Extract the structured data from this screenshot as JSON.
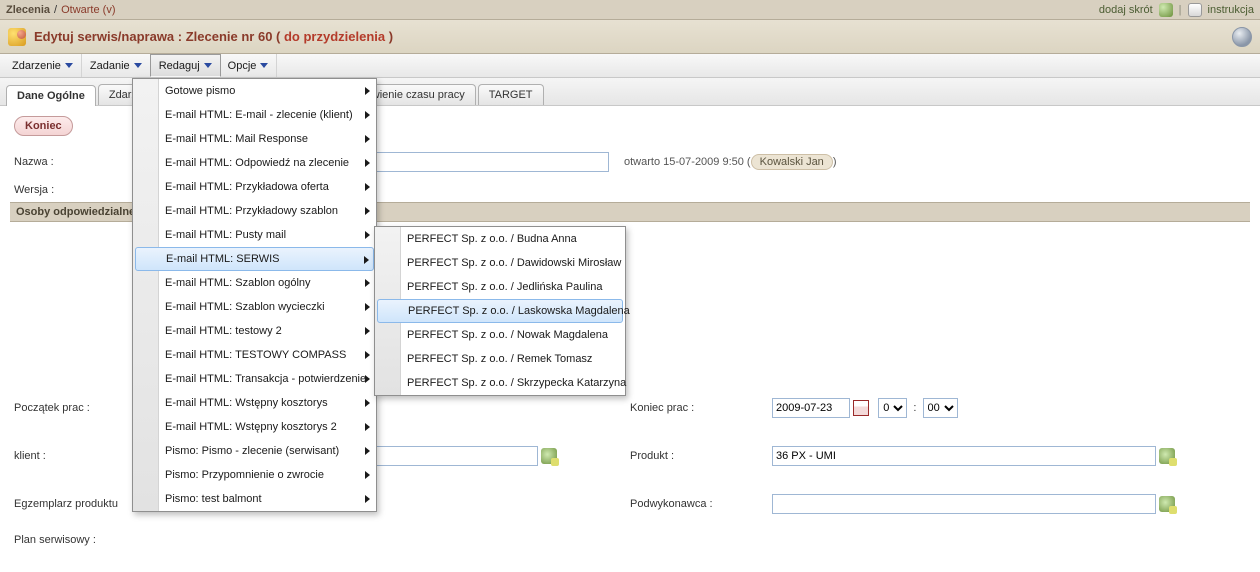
{
  "breadcrumb": {
    "root": "Zlecenia",
    "sep": "/",
    "current": "Otwarte (v)"
  },
  "toplinks": {
    "shortcut": "dodaj skrót",
    "instruction": "instrukcja"
  },
  "title": {
    "main": "Edytuj serwis/naprawa : Zlecenie nr 60 (",
    "status": " do przydzielenia ",
    "close": ")"
  },
  "menubar": {
    "items": [
      "Zdarzenie",
      "Zadanie",
      "Redaguj",
      "Opcje"
    ],
    "openIndex": 2
  },
  "tabs": {
    "items": [
      "Dane Ogólne",
      "Zdarzenia",
      "wienie czasu pracy",
      "TARGET"
    ],
    "activeIndex": 0
  },
  "buttons": {
    "koniec": "Koniec"
  },
  "labels": {
    "nazwa": "Nazwa :",
    "wersja": "Wersja :",
    "osoby": "Osoby odpowiedzialne",
    "poczatek": "Początek prac :",
    "koniecprac": "Koniec prac :",
    "klient": "klient :",
    "produkt": "Produkt :",
    "egzemplarz": "Egzemplarz produktu",
    "podwykonawca": "Podwykonawca :",
    "plan": "Plan serwisowy :"
  },
  "opened": {
    "prefix": "otwarto",
    "date": "15-07-2009 9:50",
    "who": "Kowalski Jan"
  },
  "fields": {
    "koniec_data": "2009-07-23",
    "koniec_godz": "0",
    "koniec_min": "00",
    "time_sep": ":",
    "produkt": "36 PX - UMI",
    "klient": "",
    "podwykonawca": ""
  },
  "redaguj_menu": {
    "items": [
      "Gotowe pismo",
      "E-mail HTML: E-mail - zlecenie (klient)",
      "E-mail HTML: Mail Response",
      "E-mail HTML: Odpowiedź na zlecenie",
      "E-mail HTML: Przykładowa oferta",
      "E-mail HTML: Przykładowy szablon",
      "E-mail HTML: Pusty mail",
      "E-mail HTML: SERWIS",
      "E-mail HTML: Szablon ogólny",
      "E-mail HTML: Szablon wycieczki",
      "E-mail HTML: testowy 2",
      "E-mail HTML: TESTOWY COMPASS",
      "E-mail HTML: Transakcja - potwierdzenie",
      "E-mail HTML: Wstępny kosztorys",
      "E-mail HTML: Wstępny kosztorys 2",
      "Pismo: Pismo - zlecenie (serwisant)",
      "Pismo: Przypomnienie o zwrocie",
      "Pismo: test balmont"
    ],
    "hoverIndex": 7
  },
  "serwis_submenu": {
    "items": [
      "PERFECT Sp. z o.o. / Budna Anna",
      "PERFECT Sp. z o.o. / Dawidowski Mirosław",
      "PERFECT Sp. z o.o. / Jedlińska Paulina",
      "PERFECT Sp. z o.o. / Laskowska Magdalena",
      "PERFECT Sp. z o.o. / Nowak Magdalena",
      "PERFECT Sp. z o.o. / Remek Tomasz",
      "PERFECT Sp. z o.o. / Skrzypecka Katarzyna"
    ],
    "hoverIndex": 3
  }
}
